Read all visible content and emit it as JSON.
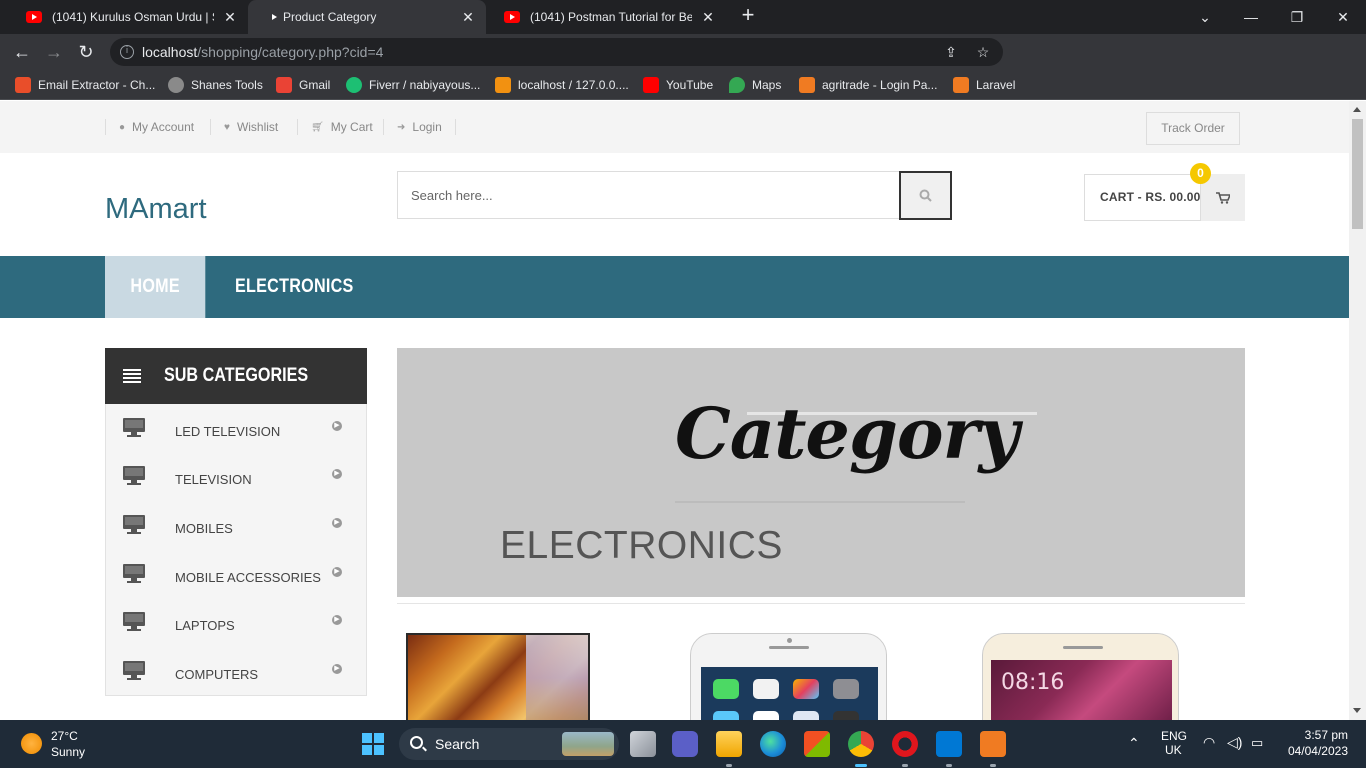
{
  "browser": {
    "tabs": [
      {
        "title": "(1041) Kurulus Osman Urdu | Sea",
        "favicon": "youtube-icon"
      },
      {
        "title": "Product Category",
        "favicon": "none"
      },
      {
        "title": "(1041) Postman Tutorial for Begin",
        "favicon": "youtube-icon"
      }
    ],
    "url_host": "localhost",
    "url_path": "/shopping/category.php?cid=4",
    "bookmarks": [
      {
        "label": "Email Extractor - Ch...",
        "color": "#e94e2a"
      },
      {
        "label": "Shanes Tools",
        "color": "#8a8a8a"
      },
      {
        "label": "Gmail",
        "color": "#ea4335"
      },
      {
        "label": "Fiverr / nabiyayous...",
        "color": "#1dbf73"
      },
      {
        "label": "localhost / 127.0.0....",
        "color": "#f29111"
      },
      {
        "label": "YouTube",
        "color": "#ff0000"
      },
      {
        "label": "Maps",
        "color": "#34a853"
      },
      {
        "label": "agritrade - Login Pa...",
        "color": "#f07b22"
      },
      {
        "label": "Laravel",
        "color": "#f07b22"
      }
    ]
  },
  "topbar": {
    "links": [
      {
        "label": "My Account",
        "icon": "user-icon"
      },
      {
        "label": "Wishlist",
        "icon": "heart-icon"
      },
      {
        "label": "My Cart",
        "icon": "cart-icon"
      },
      {
        "label": "Login",
        "icon": "sign-in-icon"
      }
    ],
    "track_order": "Track Order"
  },
  "header": {
    "logo": "MAmart",
    "search_placeholder": "Search here...",
    "cart_label": "CART - RS. 00.00",
    "cart_count": "0"
  },
  "nav": {
    "items": [
      "HOME",
      "ELECTRONICS"
    ]
  },
  "sidebar": {
    "title": "SUB CATEGORIES",
    "items": [
      "LED TELEVISION",
      "TELEVISION",
      "MOBILES",
      "MOBILE ACCESSORIES",
      "LAPTOPS",
      "COMPUTERS"
    ]
  },
  "banner": {
    "script_text": "Category",
    "category_name": "ELECTRONICS"
  },
  "products": [
    {
      "icon": "led-tv-product-image"
    },
    {
      "icon": "iphone-product-image"
    },
    {
      "icon": "redmi-phone-product-image",
      "screen_time": "08:16"
    }
  ],
  "taskbar": {
    "weather_temp": "27°C",
    "weather_cond": "Sunny",
    "search_label": "Search",
    "lang_top": "ENG",
    "lang_bottom": "UK",
    "time": "3:57 pm",
    "date": "04/04/2023"
  }
}
